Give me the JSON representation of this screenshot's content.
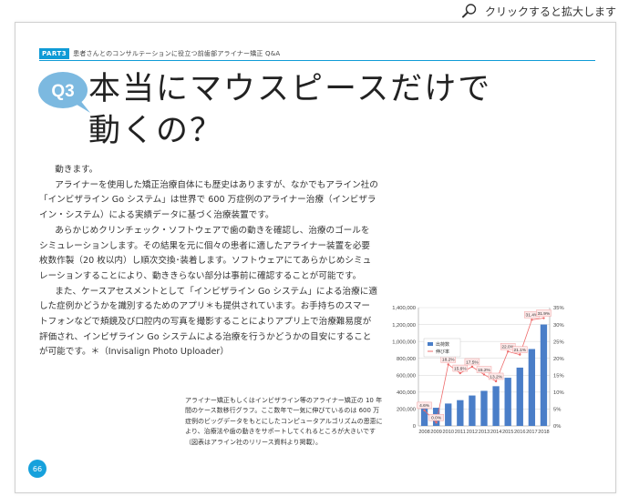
{
  "toolbar": {
    "zoom_label": "クリックすると拡大します",
    "zoom_icon": "magnifier-icon"
  },
  "header": {
    "part_badge": "PART3",
    "title": "患者さんとのコンサルテーションに役立つ前歯部アライナー矯正 Q&A"
  },
  "question": {
    "number": "Q3",
    "title_line1": "本当にマウスピースだけで",
    "title_line2": "動くの？"
  },
  "body": {
    "paragraphs": [
      "動きます。",
      "アライナーを使用した矯正治療自体にも歴史はありますが、なかでもアライン社の「インビザライン Go システム」は世界で 600 万症例のアライナー治療（インビザライン・システム）による実績データに基づく治療装置です。",
      "あらかじめクリンチェック・ソフトウェアで歯の動きを確認し、治療のゴールをシミュレーションします。その結果を元に個々の患者に適したアライナー装置を必要枚数作製（20 枚以内）し順次交換･装着します。ソフトウェアにてあらかじめシミュレーションすることにより、動ききらない部分は事前に確認することが可能です。",
      "また、ケースアセスメントとして「インビザライン Go システム」による治療に適した症例かどうかを識別するためのアプリ＊も提供されています。お手持ちのスマートフォンなどで頬鏡及び口腔内の写真を撮影することによりアプリ上で治療難易度が評価され、インビザライン Go システムによる治療を行うかどうかの目安にすることが可能です。＊（Invisalign Photo Uploader）"
    ]
  },
  "caption": "アライナー矯正もしくはインビザライン等のアライナー矯正の 10 年間のケース数移行グラフ。ここ数年で一気に伸びているのは 600 万症例のビッグデータをもとにしたコンピュータアルゴリズムの恩恵により、治療法や歯の動きをサポートしてくれるところが大きいです（図表はアライン社のリリース資料より掲載）。",
  "page_number": "66",
  "colors": {
    "accent": "#0f9bd6",
    "bubble": "#7cb9e0",
    "bar": "#4a7ec8",
    "line": "#ee6b6b"
  },
  "chart_data": {
    "type": "bar",
    "categories": [
      "2008",
      "2009",
      "2010",
      "2011",
      "2012",
      "2013",
      "2014",
      "2015",
      "2016",
      "2017",
      "2018"
    ],
    "series": [
      {
        "name": "出荷数",
        "type": "bar",
        "axis": "left",
        "values": [
          225000,
          215000,
          265000,
          305000,
          360000,
          415000,
          470000,
          570000,
          690000,
          910000,
          1200000
        ]
      },
      {
        "name": "伸び率",
        "type": "line",
        "axis": "right",
        "values": [
          4.6,
          1.0,
          18.2,
          15.6,
          17.5,
          15.2,
          13.2,
          22.0,
          21.1,
          31.4,
          31.9
        ],
        "labels": [
          "4.6%",
          "0.0%",
          "18.2%",
          "15.6%",
          "17.5%",
          "15.2%",
          "13.2%",
          "22.0%",
          "21.1%",
          "31.4%",
          "31.9%"
        ]
      }
    ],
    "left_ticks": [
      "0",
      "200,000",
      "400,000",
      "600,000",
      "800,000",
      "1,000,000",
      "1,200,000",
      "1,400,000"
    ],
    "right_ticks": [
      "0%",
      "5%",
      "10%",
      "15%",
      "20%",
      "25%",
      "30%",
      "35%"
    ],
    "ylim": [
      0,
      1400000
    ],
    "y2lim": [
      0,
      35
    ],
    "grid": true,
    "legend": "top-left"
  }
}
